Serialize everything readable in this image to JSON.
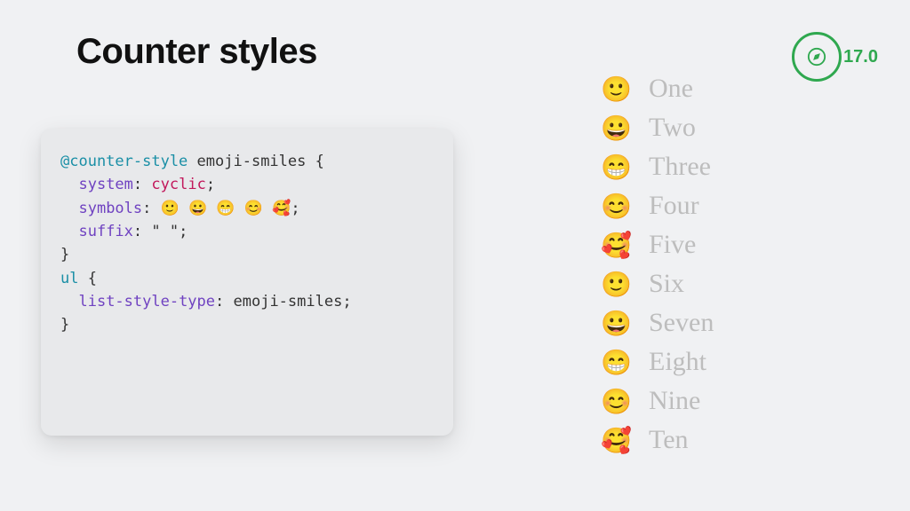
{
  "title": "Counter styles",
  "version": "17.0",
  "code": {
    "atRule": "@counter-style",
    "ruleName": "emoji-smiles",
    "openBrace": "{",
    "props": {
      "system": {
        "name": "system",
        "value": "cyclic"
      },
      "symbols": {
        "name": "symbols",
        "value": "🙂 😀 😁 😊 🥰"
      },
      "suffix": {
        "name": "suffix",
        "value": "\" \""
      }
    },
    "closeBrace": "}",
    "selector": "ul",
    "listProp": {
      "name": "list-style-type",
      "value": "emoji-smiles"
    }
  },
  "list": [
    {
      "emoji": "🙂",
      "label": "One"
    },
    {
      "emoji": "😀",
      "label": "Two"
    },
    {
      "emoji": "😁",
      "label": "Three"
    },
    {
      "emoji": "😊",
      "label": "Four"
    },
    {
      "emoji": "🥰",
      "label": "Five"
    },
    {
      "emoji": "🙂",
      "label": "Six"
    },
    {
      "emoji": "😀",
      "label": "Seven"
    },
    {
      "emoji": "😁",
      "label": "Eight"
    },
    {
      "emoji": "😊",
      "label": "Nine"
    },
    {
      "emoji": "🥰",
      "label": "Ten"
    }
  ]
}
